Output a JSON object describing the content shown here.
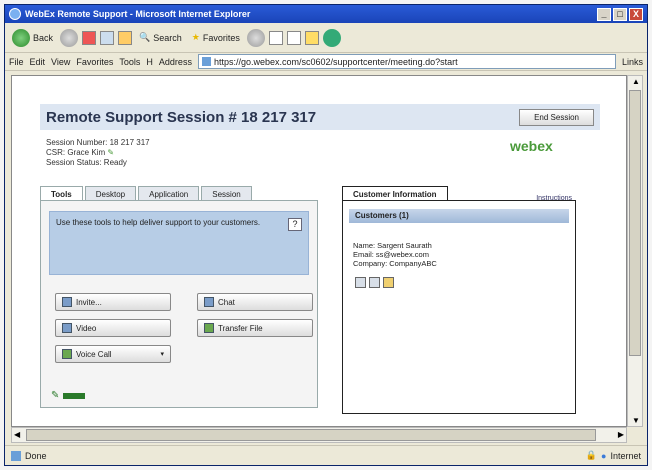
{
  "window": {
    "title": "WebEx Remote Support - Microsoft Internet Explorer",
    "minimize": "_",
    "maximize": "□",
    "close": "X"
  },
  "toolbar": {
    "back": "Back",
    "search": "Search",
    "favorites": "Favorites"
  },
  "menubar": {
    "file": "File",
    "edit": "Edit",
    "view": "View",
    "favorites": "Favorites",
    "tools": "Tools",
    "help": "H"
  },
  "address": {
    "label": "Address",
    "url": "https://go.webex.com/sc0602/supportcenter/meeting.do?start",
    "links": "Links"
  },
  "page": {
    "session_title": "Remote Support Session # 18 217 317",
    "end_session": "End Session",
    "session_number": "Session Number: 18 217 317",
    "csr": "CSR: Grace Kim",
    "status": "Session Status: Ready",
    "logo": "webex"
  },
  "left_tabs": [
    "Tools",
    "Desktop",
    "Application",
    "Session"
  ],
  "tools": {
    "help_text": "Use these tools to help deliver support to your customers.",
    "help_q": "?",
    "invite": "Invite...",
    "chat": "Chat",
    "video": "Video",
    "transfer_file": "Transfer File",
    "voice_call": "Voice Call",
    "caret": "▾"
  },
  "right": {
    "tab": "Customer Information",
    "instructions": "Instructions",
    "customers_header": "Customers (1)",
    "name": "Name: Sargent Saurath",
    "email": "Email: ss@webex.com",
    "company": "Company: CompanyABC"
  },
  "status": {
    "done": "Done",
    "zone": "Internet"
  }
}
